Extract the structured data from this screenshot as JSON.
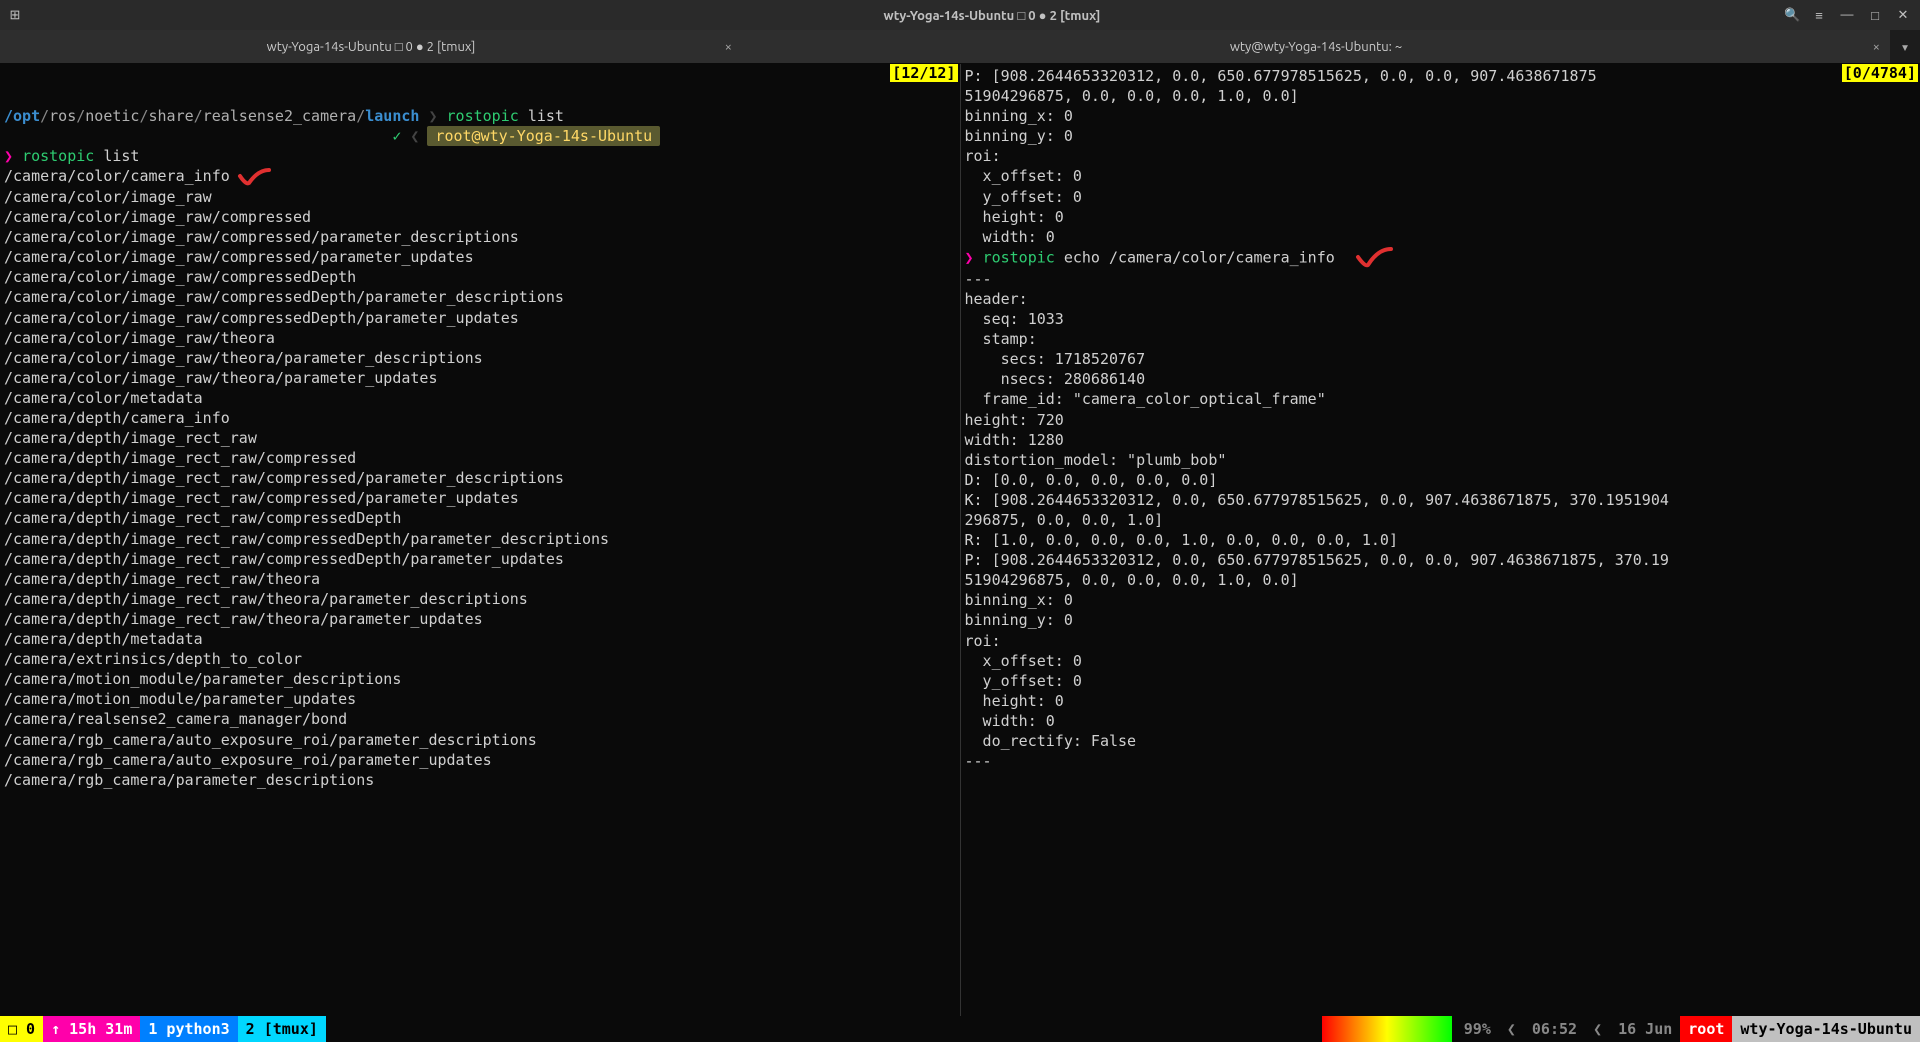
{
  "window": {
    "title": "wty-Yoga-14s-Ubuntu □ 0 ● 2 [tmux]"
  },
  "tabs": {
    "tab1": "wty-Yoga-14s-Ubuntu □ 0 ● 2 [tmux]",
    "tab2": "wty@wty-Yoga-14s-Ubuntu: ~"
  },
  "left_pane": {
    "counter": "[12/12]",
    "path": {
      "root": "/opt",
      "segs": [
        "ros",
        "noetic",
        "share",
        "realsense2_camera"
      ],
      "last": "launch"
    },
    "cmd1": "rostopic",
    "cmd1_arg": "list",
    "user_badge": "root@wty-Yoga-14s-Ubuntu",
    "prompt_cmd": "rostopic",
    "prompt_arg": "list",
    "topics": [
      "/camera/color/camera_info",
      "/camera/color/image_raw",
      "/camera/color/image_raw/compressed",
      "/camera/color/image_raw/compressed/parameter_descriptions",
      "/camera/color/image_raw/compressed/parameter_updates",
      "/camera/color/image_raw/compressedDepth",
      "/camera/color/image_raw/compressedDepth/parameter_descriptions",
      "/camera/color/image_raw/compressedDepth/parameter_updates",
      "/camera/color/image_raw/theora",
      "/camera/color/image_raw/theora/parameter_descriptions",
      "/camera/color/image_raw/theora/parameter_updates",
      "/camera/color/metadata",
      "/camera/depth/camera_info",
      "/camera/depth/image_rect_raw",
      "/camera/depth/image_rect_raw/compressed",
      "/camera/depth/image_rect_raw/compressed/parameter_descriptions",
      "/camera/depth/image_rect_raw/compressed/parameter_updates",
      "/camera/depth/image_rect_raw/compressedDepth",
      "/camera/depth/image_rect_raw/compressedDepth/parameter_descriptions",
      "/camera/depth/image_rect_raw/compressedDepth/parameter_updates",
      "/camera/depth/image_rect_raw/theora",
      "/camera/depth/image_rect_raw/theora/parameter_descriptions",
      "/camera/depth/image_rect_raw/theora/parameter_updates",
      "/camera/depth/metadata",
      "/camera/extrinsics/depth_to_color",
      "/camera/motion_module/parameter_descriptions",
      "/camera/motion_module/parameter_updates",
      "/camera/realsense2_camera_manager/bond",
      "/camera/rgb_camera/auto_exposure_roi/parameter_descriptions",
      "/camera/rgb_camera/auto_exposure_roi/parameter_updates",
      "/camera/rgb_camera/parameter_descriptions"
    ]
  },
  "right_pane": {
    "counter": "[0/4784]",
    "top_lines": [
      "P: [908.2644653320312, 0.0, 650.677978515625, 0.0, 0.0, 907.4638671875",
      "51904296875, 0.0, 0.0, 0.0, 1.0, 0.0]",
      "binning_x: 0",
      "binning_y: 0",
      "roi:",
      "  x_offset: 0",
      "  y_offset: 0",
      "  height: 0",
      "  width: 0"
    ],
    "prompt_cmd": "rostopic",
    "prompt_arg": "echo /camera/color/camera_info",
    "body_lines": [
      "---",
      "header:",
      "  seq: 1033",
      "  stamp:",
      "    secs: 1718520767",
      "    nsecs: 280686140",
      "  frame_id: \"camera_color_optical_frame\"",
      "height: 720",
      "width: 1280",
      "distortion_model: \"plumb_bob\"",
      "D: [0.0, 0.0, 0.0, 0.0, 0.0]",
      "K: [908.2644653320312, 0.0, 650.677978515625, 0.0, 907.4638671875, 370.1951904",
      "296875, 0.0, 0.0, 1.0]",
      "R: [1.0, 0.0, 0.0, 0.0, 1.0, 0.0, 0.0, 0.0, 1.0]",
      "P: [908.2644653320312, 0.0, 650.677978515625, 0.0, 0.0, 907.4638671875, 370.19",
      "51904296875, 0.0, 0.0, 0.0, 1.0, 0.0]",
      "binning_x: 0",
      "binning_y: 0",
      "roi:",
      "  x_offset: 0",
      "  y_offset: 0",
      "  height: 0",
      "  width: 0",
      "  do_rectify: False",
      "---",
      " "
    ]
  },
  "statusbar": {
    "session": "□ 0",
    "uptime": "↑ 15h 31m",
    "win1": "1 python3",
    "win2": "2 [tmux]",
    "battery": "99%",
    "time": "06:52",
    "date": "16 Jun",
    "user": "root",
    "host": "wty-Yoga-14s-Ubuntu"
  }
}
